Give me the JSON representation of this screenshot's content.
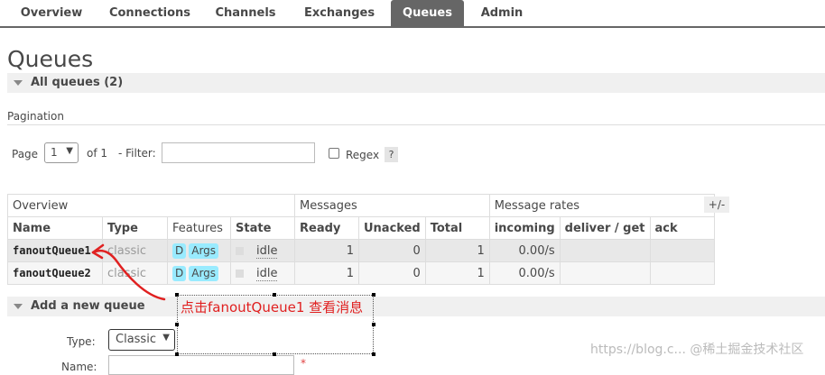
{
  "nav": {
    "tabs": [
      {
        "label": "Overview",
        "selected": false
      },
      {
        "label": "Connections",
        "selected": false
      },
      {
        "label": "Channels",
        "selected": false
      },
      {
        "label": "Exchanges",
        "selected": false
      },
      {
        "label": "Queues",
        "selected": true
      },
      {
        "label": "Admin",
        "selected": false
      }
    ]
  },
  "page_title": "Queues",
  "all_queues": {
    "label": "All queues (2)"
  },
  "pagination": {
    "label": "Pagination",
    "page_label": "Page",
    "page_value": "1",
    "of_label": "of 1",
    "filter_label": "- Filter:",
    "filter_value": "",
    "regex_label": "Regex",
    "regex_checked": false,
    "help_label": "?"
  },
  "table": {
    "group_headers": {
      "overview": "Overview",
      "messages": "Messages",
      "message_rates": "Message rates"
    },
    "columns": {
      "name": "Name",
      "type": "Type",
      "features": "Features",
      "state": "State",
      "ready": "Ready",
      "unacked": "Unacked",
      "total": "Total",
      "incoming": "incoming",
      "deliver_get": "deliver / get",
      "ack": "ack"
    },
    "toggle_label": "+/-",
    "rows": [
      {
        "name": "fanoutQueue1",
        "type": "classic",
        "feature_d": "D",
        "feature_args": "Args",
        "state": "idle",
        "ready": "1",
        "unacked": "0",
        "total": "1",
        "incoming": "0.00/s",
        "deliver_get": "",
        "ack": ""
      },
      {
        "name": "fanoutQueue2",
        "type": "classic",
        "feature_d": "D",
        "feature_args": "Args",
        "state": "idle",
        "ready": "1",
        "unacked": "0",
        "total": "1",
        "incoming": "0.00/s",
        "deliver_get": "",
        "ack": ""
      }
    ]
  },
  "add_queue": {
    "label": "Add a new queue",
    "type_label": "Type:",
    "type_value": "Classic",
    "name_label": "Name:",
    "required_mark": "*"
  },
  "annotation": {
    "text": "点击fanoutQueue1 查看消息",
    "color": "#e02020"
  },
  "watermark": "https://blog.c... @稀土掘金技术社区",
  "colors": {
    "selected_tab": "#666666",
    "feature_tag": "#99ebff",
    "row_bg": "#e8e8e8",
    "annotation": "#e02020"
  }
}
